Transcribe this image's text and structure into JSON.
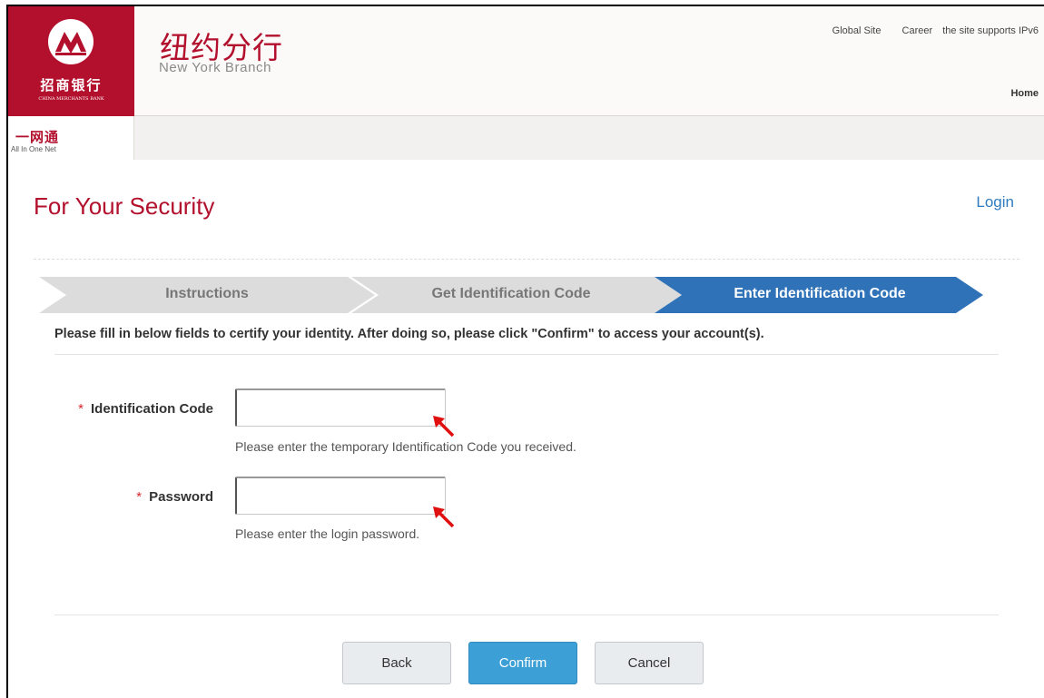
{
  "header": {
    "logo_cn": "招商银行",
    "logo_en": "CHINA MERCHANTS BANK",
    "branch_cn": "纽约分行",
    "branch_en": "New York Branch",
    "links": [
      "Global Site",
      "Career",
      "the site supports IPv6"
    ],
    "home": "Home",
    "brand_color": "#b3102d"
  },
  "subbar": {
    "logo_cn": "一网通",
    "logo_en": "All In One Net"
  },
  "page": {
    "title": "For Your Security",
    "login_link": "Login"
  },
  "steps": [
    {
      "label": "Instructions",
      "active": false
    },
    {
      "label": "Get Identification Code",
      "active": false
    },
    {
      "label": "Enter Identification Code",
      "active": true
    }
  ],
  "instructions": "Please fill in below fields to certify your identity. After doing so, please click \"Confirm\" to access your account(s).",
  "form": {
    "required_mark": "*",
    "identification_code": {
      "label": "Identification Code",
      "value": "",
      "hint": "Please enter the temporary Identification Code you received."
    },
    "password": {
      "label": "Password",
      "value": "",
      "hint": "Please enter the login password."
    }
  },
  "buttons": {
    "back": "Back",
    "confirm": "Confirm",
    "cancel": "Cancel"
  },
  "colors": {
    "accent": "#b3102d",
    "step_active": "#2f72b8",
    "confirm": "#3c9fd6",
    "link": "#2f7cc0",
    "annotation_arrow": "#e01010"
  }
}
